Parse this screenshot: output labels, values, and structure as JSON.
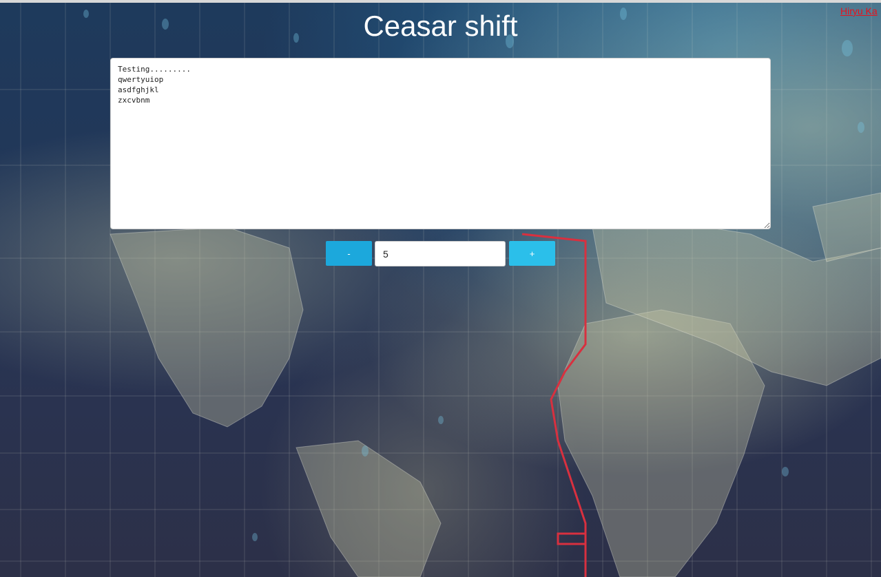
{
  "page": {
    "title": "Ceasar shift",
    "author_link": "Hiryu Ka"
  },
  "editor": {
    "text": "Testing.........\nqwertyuiop\nasdfghjkl\nzxcvbnm"
  },
  "controls": {
    "decrement_label": "-",
    "increment_label": "+",
    "shift_value": "5"
  },
  "colors": {
    "title": "#ffffff",
    "link": "#e8121c",
    "button_minus": "#1ca8dc",
    "button_plus": "#2bbfea"
  }
}
